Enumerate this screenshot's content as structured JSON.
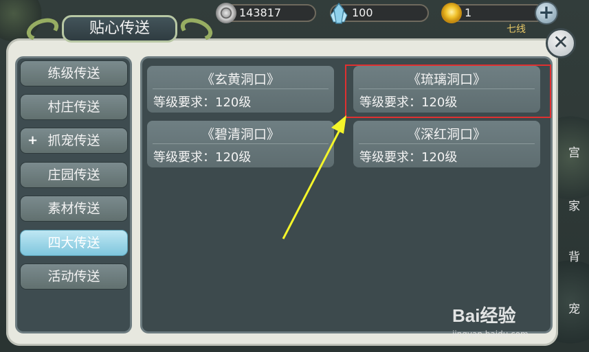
{
  "resources": {
    "coins": "143817",
    "crystals": "100",
    "gold": "1",
    "plus_label": "+",
    "hint_text": "七线"
  },
  "window": {
    "title": "贴心传送",
    "close_label": "✕"
  },
  "sidebar": {
    "items": [
      {
        "label": "练级传送"
      },
      {
        "label": "村庄传送"
      },
      {
        "label": "抓宠传送",
        "marker": "+"
      },
      {
        "label": "庄园传送"
      },
      {
        "label": "素材传送"
      },
      {
        "label": "四大传送",
        "active": true
      },
      {
        "label": "活动传送"
      }
    ]
  },
  "destinations": [
    {
      "name": "《玄黄洞口》",
      "requirement": "等级要求：120级"
    },
    {
      "name": "《琉璃洞口》",
      "requirement": "等级要求：120级",
      "highlighted": true
    },
    {
      "name": "《碧清洞口》",
      "requirement": "等级要求：120级"
    },
    {
      "name": "《深红洞口》",
      "requirement": "等级要求：120级"
    }
  ],
  "right_edge_labels": [
    "宫",
    "家",
    "背",
    "宠"
  ],
  "watermark": {
    "brand": "Bai经验",
    "url": "jingyan.baidu.com"
  },
  "colors": {
    "highlight_box": "#e03030",
    "arrow": "#f4f52a",
    "active_tab": "#9fd8ea"
  }
}
